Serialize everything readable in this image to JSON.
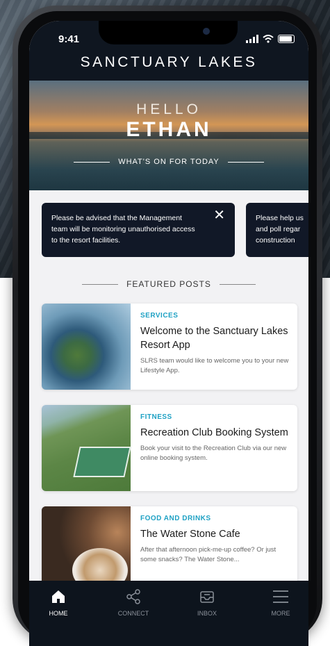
{
  "status_bar": {
    "time": "9:41"
  },
  "header": {
    "title": "SANCTUARY LAKES"
  },
  "hero": {
    "greeting": "HELLO",
    "name": "ETHAN",
    "subtitle": "WHAT'S ON FOR TODAY"
  },
  "notices": [
    {
      "text": "Please be advised that the Management team will be monitoring unauthorised access to the resort facilities."
    },
    {
      "text": "Please help us and poll regar construction"
    }
  ],
  "featured": {
    "heading": "FEATURED POSTS"
  },
  "posts": [
    {
      "category": "SERVICES",
      "title": "Welcome to the Sanctuary Lakes Resort App",
      "description": "SLRS team would like to welcome you to your new Lifestyle App."
    },
    {
      "category": "FITNESS",
      "title": "Recreation Club Booking System",
      "description": "Book your visit to the Recreation Club via our new online booking system."
    },
    {
      "category": "FOOD AND DRINKS",
      "title": "The Water Stone Cafe",
      "description": "After that afternoon pick-me-up coffee? Or just some snacks? The Water Stone..."
    }
  ],
  "nav": {
    "items": [
      {
        "label": "HOME",
        "icon": "home-icon",
        "active": true
      },
      {
        "label": "CONNECT",
        "icon": "share-icon",
        "active": false
      },
      {
        "label": "INBOX",
        "icon": "inbox-icon",
        "active": false
      },
      {
        "label": "MORE",
        "icon": "menu-icon",
        "active": false
      }
    ]
  },
  "colors": {
    "header_bg": "#0f1620",
    "accent": "#1ea1c4",
    "notice_bg": "#111827",
    "nav_bg": "#0d141d"
  }
}
